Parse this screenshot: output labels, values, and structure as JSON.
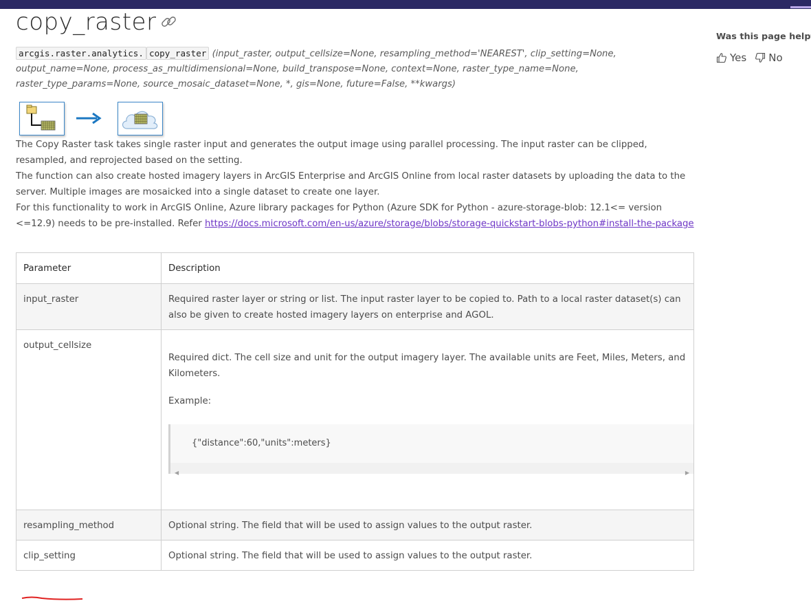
{
  "page": {
    "title": "copy_raster"
  },
  "signature": {
    "module": "arcgis.raster.analytics.",
    "function": "copy_raster",
    "params": "(input_raster, output_cellsize=None, resampling_method='NEAREST', clip_setting=None, output_name=None, process_as_multidimensional=None, build_transpose=None, context=None, raster_type_name=None, raster_type_params=None, source_mosaic_dataset=None, *, gis=None, future=False, **kwargs)"
  },
  "body": {
    "para1": "The Copy Raster task takes single raster input and generates the output image using parallel processing. The input raster can be clipped, resampled, and reprojected based on the setting.",
    "para2": "The function can also create hosted imagery layers in ArcGIS Enterprise and ArcGIS Online from local raster datasets by uploading the data to the server. Multiple images are mosaicked into a single dataset to create one layer.",
    "para3_text": "For this functionality to work in ArcGIS Online, Azure library packages for Python (Azure SDK for Python - azure-storage-blob: 12.1<= version <=12.9) needs to be pre-installed. Refer ",
    "para3_link": "https://docs.microsoft.com/en-us/azure/storage/blobs/storage-quickstart-blobs-python#install-the-package"
  },
  "table": {
    "header_parameter": "Parameter",
    "header_description": "Description",
    "rows": [
      {
        "name": "input_raster",
        "desc": "Required raster layer or string or list. The input raster layer to be copied to. Path to a local raster dataset(s) can also be given to create hosted imagery layers on enterprise and AGOL."
      },
      {
        "name": "output_cellsize",
        "desc": "Required dict. The cell size and unit for the output imagery layer. The available units are Feet, Miles, Meters, and Kilometers.",
        "example_label": "Example:",
        "example_code": "{\"distance\":60,\"units\":meters}"
      },
      {
        "name": "resampling_method",
        "desc": "Optional string. The field that will be used to assign values to the output raster."
      },
      {
        "name": "clip_setting",
        "desc": "Optional string. The field that will be used to assign values to the output raster."
      }
    ]
  },
  "feedback": {
    "question": "Was this page helpful?",
    "yes": "Yes",
    "no": "No"
  },
  "colors": {
    "topbar": "#2b2964",
    "link": "#6e36c6",
    "diagram_border": "#3a86c8",
    "annotation": "#e0201f"
  }
}
